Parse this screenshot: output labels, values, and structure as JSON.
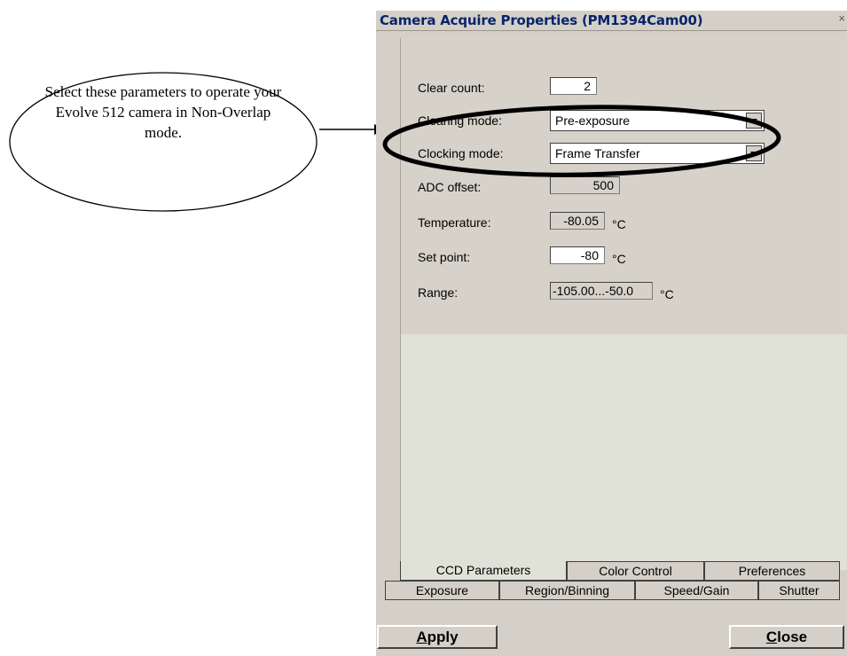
{
  "annotation": {
    "text": "Select these parameters to operate your Evolve 512 camera in Non-Overlap mode."
  },
  "window": {
    "title": "Camera Acquire Properties (PM1394Cam00)",
    "close_glyph": "×"
  },
  "fields": {
    "clear_count": {
      "label": "Clear count:",
      "value": "2"
    },
    "clearing_mode": {
      "label": "Clearing mode:",
      "value": "Pre-exposure"
    },
    "clocking_mode": {
      "label": "Clocking mode:",
      "value": "Frame Transfer"
    },
    "adc_offset": {
      "label": "ADC offset:",
      "value": "500"
    },
    "temperature": {
      "label": "Temperature:",
      "value": "-80.05",
      "unit": "°C"
    },
    "set_point": {
      "label": "Set point:",
      "value": "-80",
      "unit": "°C"
    },
    "range": {
      "label": "Range:",
      "value": "-105.00...-50.0",
      "unit": "°C"
    }
  },
  "tabs_row1": [
    "CCD Parameters",
    "Color Control",
    "Preferences"
  ],
  "tabs_row2": [
    "Exposure",
    "Region/Binning",
    "Speed/Gain",
    "Shutter"
  ],
  "buttons": {
    "apply_mnemonic": "A",
    "apply_rest": "pply",
    "close_mnemonic": "C",
    "close_rest": "lose"
  },
  "colors": {
    "title_text": "#0a246a",
    "dialog_face": "#d4d0c8",
    "highlight_ellipse": "#000000"
  }
}
